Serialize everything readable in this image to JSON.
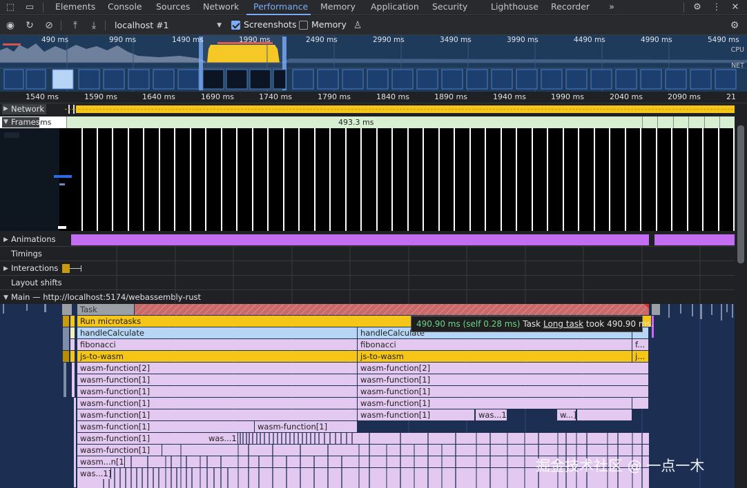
{
  "tabbar": {
    "tabs": [
      {
        "label": "Elements"
      },
      {
        "label": "Console"
      },
      {
        "label": "Sources"
      },
      {
        "label": "Network"
      },
      {
        "label": "Performance"
      },
      {
        "label": "Memory"
      },
      {
        "label": "Application"
      },
      {
        "label": "Security"
      },
      {
        "label": "Lighthouse"
      },
      {
        "label": "Recorder"
      }
    ],
    "more_icon": "double-chevron-right-icon",
    "settings_icon": "gear-icon",
    "menu_icon": "vertical-dots-icon",
    "close_icon": "close-icon"
  },
  "toolbar": {
    "profile": "localhost #1",
    "screenshots_label": "Screenshots",
    "screenshots_checked": true,
    "memory_label": "Memory",
    "memory_checked": false
  },
  "overview": {
    "ticks": [
      "490 ms",
      "990 ms",
      "1490 ms",
      "1990 ms",
      "2490 ms",
      "2990 ms",
      "3490 ms",
      "3990 ms",
      "4490 ms",
      "4990 ms",
      "5490 ms"
    ],
    "cpu_label": "CPU",
    "net_label": "NET"
  },
  "ruler": {
    "ticks": [
      "1540 ms",
      "1590 ms",
      "1640 ms",
      "1690 ms",
      "1740 ms",
      "1790 ms",
      "1840 ms",
      "1890 ms",
      "1940 ms",
      "1990 ms",
      "2040 ms",
      "2090 ms",
      "21"
    ]
  },
  "tracks": {
    "network": "Network",
    "frames": "Frames",
    "frames_left": "ms",
    "frame_duration": "493.3 ms",
    "animations": "Animations",
    "timings": "Timings",
    "interactions": "Interactions",
    "layout_shifts": "Layout shifts",
    "main": "Main — http://localhost:5174/webassembly-rust"
  },
  "flame": {
    "task": "Task",
    "microtasks": "Run microtasks",
    "handle": "handleCalculate",
    "fib": "fibonacci",
    "jstowasm": "js-to-wasm",
    "f_short": "f...",
    "j_short": "j...",
    "wf2": "wasm-function[2]",
    "wf1": "wasm-function[1]",
    "was1": "was...1]",
    "w1": "w...]",
    "wasmn": "wasm...n[1]"
  },
  "tooltip": {
    "time": "490.90 ms (self 0.28 ms)",
    "task": "Task",
    "link": "Long task",
    "rest": "took 490.90 ms."
  },
  "watermark": "掘金技术社区 @ 一点一木",
  "colors": {
    "accent": "#7cacf8",
    "task_yellow": "#f5c518",
    "wasm_pink": "#e3c8f0",
    "handler_blue": "#b7d6f5",
    "animation_purple": "#c36ef0",
    "long_task_red": "#d9534f"
  }
}
